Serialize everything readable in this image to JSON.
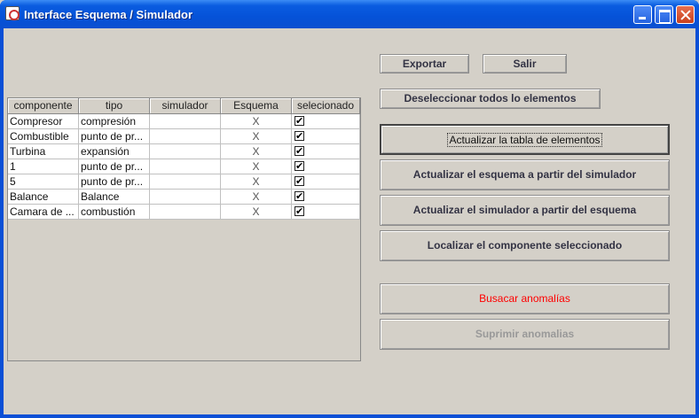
{
  "window": {
    "title": "Interface Esquema / Simulador"
  },
  "toolbar": {
    "export_label": "Exportar",
    "exit_label": "Salir",
    "deselect_label": "Deseleccionar todos lo elementos"
  },
  "actions": {
    "update_table": "Actualizar la tabla de elementos",
    "update_scheme": "Actualizar el esquema a partir del simulador",
    "update_simulator": "Actualizar el simulador a partir del esquema",
    "locate_component": "Localizar el componente seleccionado",
    "find_anomalies": "Busacar anomalías",
    "remove_anomalies": "Suprimir anomalias"
  },
  "colors": {
    "anomaly_text": "#ff0000",
    "disabled_text": "#999999"
  },
  "table": {
    "columns": [
      "componente",
      "tipo",
      "simulador",
      "Esquema",
      "selecionado"
    ],
    "rows": [
      {
        "componente": "Compresor",
        "tipo": "compresión",
        "simulador": "",
        "esquema": "X",
        "selecionado": true
      },
      {
        "componente": "Combustible",
        "tipo": "punto de pr...",
        "simulador": "",
        "esquema": "X",
        "selecionado": true
      },
      {
        "componente": "Turbina",
        "tipo": "expansión",
        "simulador": "",
        "esquema": "X",
        "selecionado": true
      },
      {
        "componente": "1",
        "tipo": "punto de pr...",
        "simulador": "",
        "esquema": "X",
        "selecionado": true
      },
      {
        "componente": "5",
        "tipo": "punto de pr...",
        "simulador": "",
        "esquema": "X",
        "selecionado": true
      },
      {
        "componente": "Balance",
        "tipo": "Balance",
        "simulador": "",
        "esquema": "X",
        "selecionado": true
      },
      {
        "componente": "Camara de ...",
        "tipo": "combustión",
        "simulador": "",
        "esquema": "X",
        "selecionado": true
      }
    ]
  }
}
